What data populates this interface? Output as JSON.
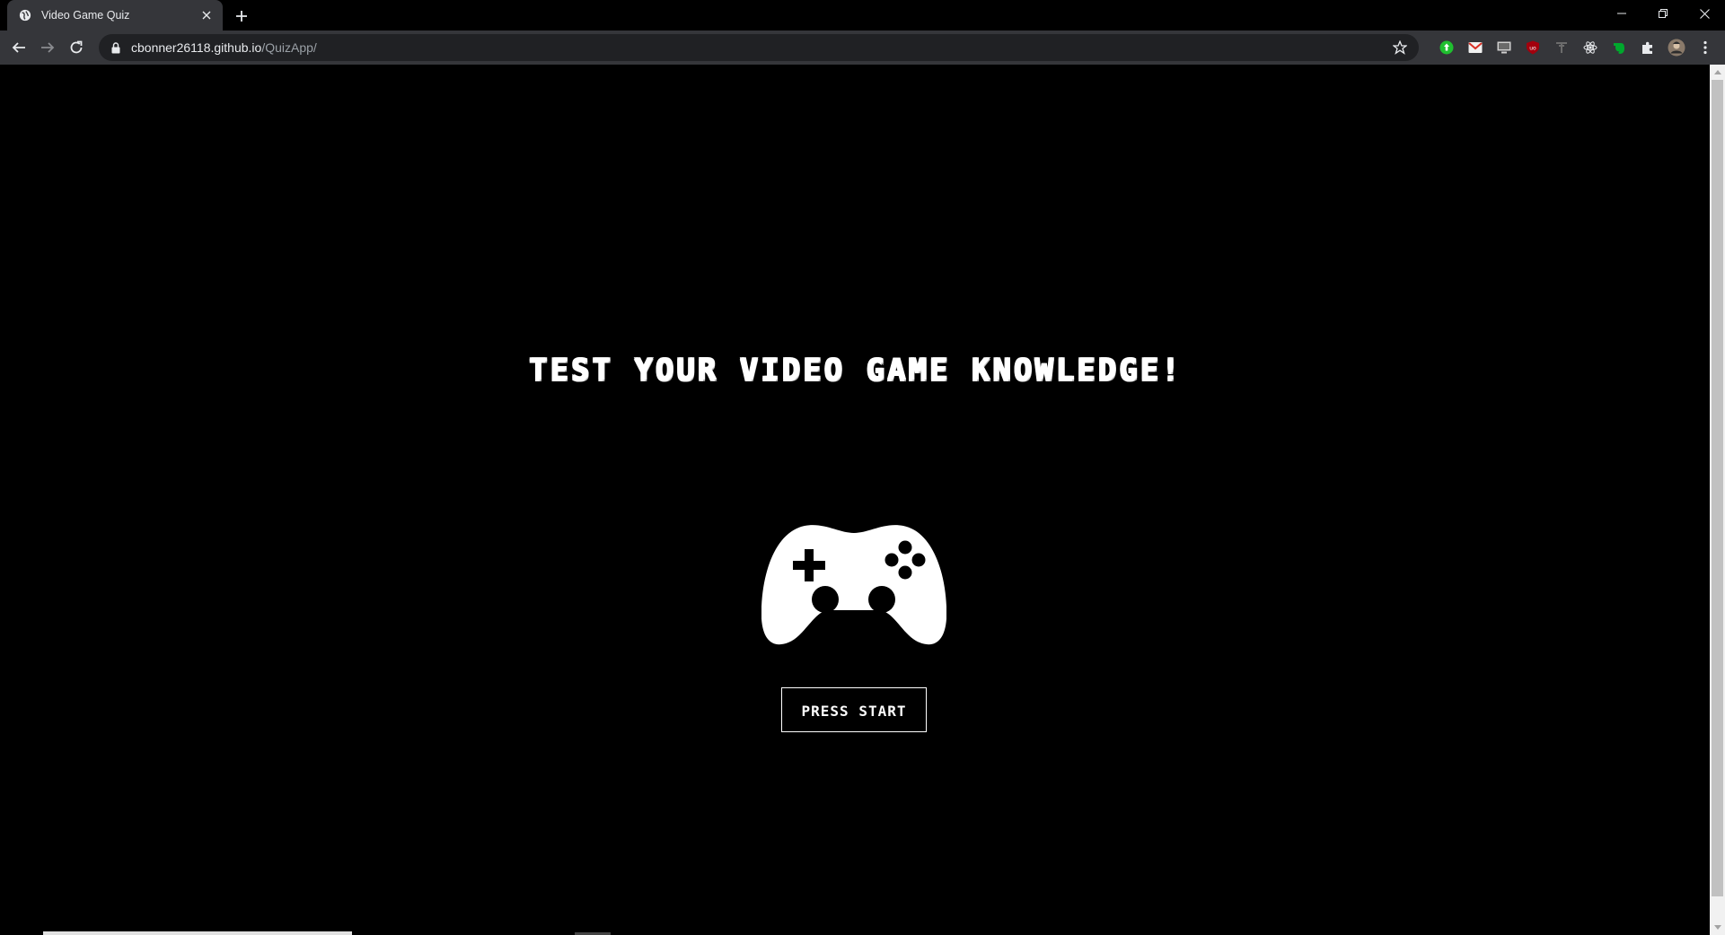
{
  "browser": {
    "tab": {
      "title": "Video Game Quiz",
      "favicon": "globe-icon"
    },
    "new_tab_icon": "plus-icon",
    "window_controls": [
      "minimize-icon",
      "restore-icon",
      "close-icon"
    ],
    "nav": [
      "back-arrow-icon",
      "forward-arrow-icon",
      "reload-icon"
    ],
    "address": {
      "host": "cbonner26118.github.io",
      "path": "/QuizApp/",
      "lock_icon": "lock-icon",
      "bookmark_icon": "star-icon"
    },
    "extensions": [
      "green-extension-icon",
      "gmail-extension-icon",
      "screen-extension-icon",
      "ublock-extension-icon",
      "grey-extension-icon",
      "react-devtools-icon",
      "evernote-icon",
      "puzzle-extensions-icon",
      "profile-avatar",
      "kebab-menu-icon"
    ]
  },
  "page": {
    "headline": "TEST YOUR VIDEO GAME KNOWLEDGE!",
    "icon": "game-controller-icon",
    "start_button": "PRESS START"
  },
  "colors": {
    "page_bg": "#000000",
    "text": "#ffffff",
    "chrome_dark": "#35363a",
    "omnibox": "#202124"
  }
}
